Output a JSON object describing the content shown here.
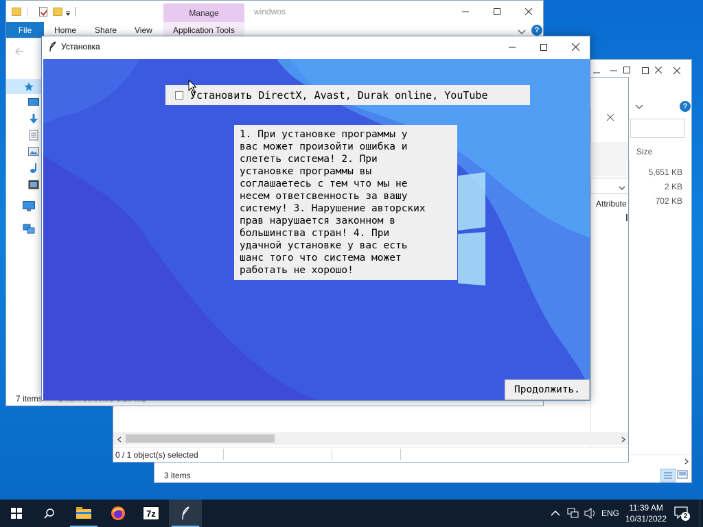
{
  "back_window_3": {
    "size_header": "",
    "status": "3 items"
  },
  "back_window_2": {
    "size_header": "Size",
    "attribute_header": "Attribute",
    "sizes": [
      "5,651 KB",
      "2 KB",
      "702 KB"
    ],
    "status": "0 / 1 object(s) selected"
  },
  "explorer": {
    "title": "windwos",
    "manage_label": "Manage",
    "tabs": [
      "File",
      "Home",
      "Share",
      "View",
      "Application Tools"
    ],
    "status_items": "7 items",
    "status_selected": "1 item selected  6.20 MB"
  },
  "dialog": {
    "title": "Установка",
    "checkbox_label": "Установить DirectX, Avast, Durak online, YouTube",
    "checkbox_checked": false,
    "terms": "1. При установке программы у\nвас может произойти ошибка и\nслететь система! 2. При\nустановке программы вы\nсоглашаетесь с тем что мы не\nнесем ответсвенность за вашу\nсистему! 3. Нарушение авторских\nправ нарушается законном в\nбольшинства стран! 4. При\nудачной установке у вас есть\nшанс того что система может\nработать не хорошо!",
    "continue_label": "Продолжить."
  },
  "taskbar": {
    "items": [
      "start-icon",
      "search-icon",
      "file-explorer-icon",
      "firefox-icon",
      "7zip-icon",
      "feather-app-icon"
    ],
    "language": "ENG",
    "time": "11:39 AM",
    "date": "10/31/2022",
    "notification_count": "2",
    "sevenzip_label": "7z"
  },
  "colors": {
    "desktop": "#0a6ccf",
    "accent": "#1979ca",
    "manage_tab": "#e8c9f0",
    "taskbar": "#101d2e"
  }
}
